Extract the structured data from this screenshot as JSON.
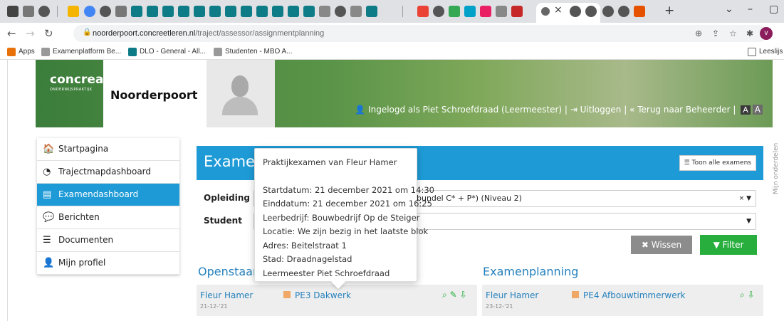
{
  "browser": {
    "url_host": "noorderpoort.concreetleren.nl",
    "url_path": "/traject/assessor/assignmentplanning",
    "avatar_letter": "v",
    "bookmarks": [
      "Apps",
      "Examenplatform Be...",
      "DLO - General - All...",
      "Studenten - MBO A..."
    ],
    "reading_list": "Leeslijs"
  },
  "header": {
    "logo_concreat": "concreat.",
    "logo_noorderpoort": "Noorderpoort",
    "user_text": "Ingelogd als Piet Schroefdraad (Leermeester)",
    "logout": "Uitloggen",
    "back": "Terug naar Beheerder",
    "font_small": "A",
    "font_large": "A"
  },
  "menu": {
    "items": [
      {
        "label": "Startpagina",
        "icon": "home-icon"
      },
      {
        "label": "Trajectmapdashboard",
        "icon": "dashboard-icon"
      },
      {
        "label": "Examendashboard",
        "icon": "document-icon",
        "active": true
      },
      {
        "label": "Berichten",
        "icon": "chat-icon"
      },
      {
        "label": "Documenten",
        "icon": "database-icon"
      },
      {
        "label": "Mijn profiel",
        "icon": "user-icon"
      }
    ]
  },
  "main": {
    "title": "Examen",
    "toon_alle": "Toon alle examens",
    "filters": {
      "opleiding_label": "Opleiding",
      "opleiding_value": "bundel C* + P*) (Niveau 2)",
      "student_label": "Student"
    },
    "wissen": "Wissen",
    "filter": "Filter",
    "openstaande": "Openstaan",
    "planning": "Examenplanning",
    "cards": [
      {
        "name": "Fleur Hamer",
        "date": "21-12-'21",
        "exam": "PE3 Dakwerk"
      },
      {
        "name": "Fleur Hamer",
        "date": "23-12-'21",
        "exam": "PE4 Afbouwtimmerwerk"
      }
    ]
  },
  "tooltip": {
    "title": "Praktijkexamen van Fleur Hamer",
    "lines": [
      "Startdatum: 21 december 2021 om 14:30",
      "Einddatum: 21 december 2021 om 16:25",
      "Leerbedrijf: Bouwbedrijf Op de Steiger",
      "Locatie: We zijn bezig in het laatste blok",
      "Adres: Beitelstraat 1",
      "Stad: Draadnagelstad",
      "Leermeester Piet Schroefdraad"
    ]
  },
  "side_tab": "Mijn onderdelen"
}
